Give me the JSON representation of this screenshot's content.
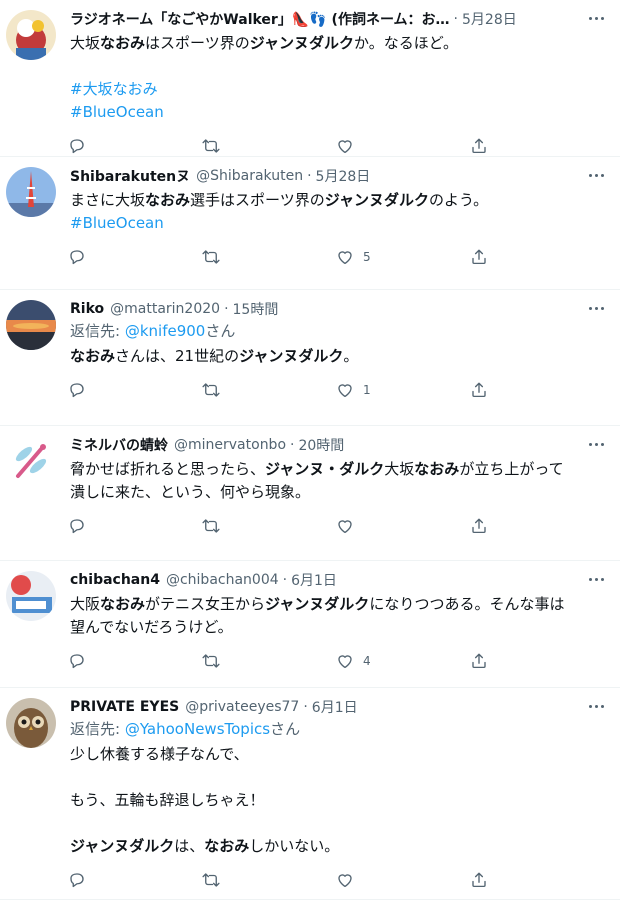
{
  "tweets": [
    {
      "name": "ラジオネーム「なごやかWalker」👠👣 (作詞ネーム：お…",
      "handle": "",
      "time": "5月28日",
      "reply_to": null,
      "lines": [
        [
          {
            "t": "大坂"
          },
          {
            "t": "なおみ",
            "b": true
          },
          {
            "t": "はスポーツ界の"
          },
          {
            "t": "ジャンヌダルク",
            "b": true
          },
          {
            "t": "か。なるほど。"
          }
        ],
        [],
        [
          {
            "t": "#大坂なおみ",
            "tag": true
          }
        ],
        [
          {
            "t": "#BlueOcean",
            "tag": true
          }
        ]
      ],
      "counts": {
        "reply": "",
        "retweet": "",
        "like": "",
        "share": ""
      }
    },
    {
      "name": "Shibarakutenヌ",
      "handle": "@Shibarakuten",
      "time": "5月28日",
      "reply_to": null,
      "lines": [
        [
          {
            "t": "まさに大坂"
          },
          {
            "t": "なおみ",
            "b": true
          },
          {
            "t": "選手はスポーツ界の"
          },
          {
            "t": "ジャンヌダルク",
            "b": true
          },
          {
            "t": "のよう。"
          }
        ],
        [
          {
            "t": "#BlueOcean",
            "tag": true
          }
        ]
      ],
      "counts": {
        "reply": "",
        "retweet": "",
        "like": "5",
        "share": ""
      }
    },
    {
      "name": "Riko",
      "handle": "@mattarin2020",
      "time": "15時間",
      "reply_to": {
        "label": "返信先: ",
        "user": "@knife900",
        "suffix": "さん"
      },
      "lines": [
        [
          {
            "t": "なおみ",
            "b": true
          },
          {
            "t": "さんは、21世紀の"
          },
          {
            "t": "ジャンヌダルク",
            "b": true
          },
          {
            "t": "。"
          }
        ]
      ],
      "counts": {
        "reply": "",
        "retweet": "",
        "like": "1",
        "share": ""
      }
    },
    {
      "name": "ミネルバの蜻蛉",
      "handle": "@minervatonbo",
      "time": "20時間",
      "reply_to": null,
      "lines": [
        [
          {
            "t": "脅かせば折れると思ったら、"
          },
          {
            "t": "ジャンヌ・ダルク",
            "b": true
          },
          {
            "t": "大坂"
          },
          {
            "t": "なおみ",
            "b": true
          },
          {
            "t": "が立ち上がって"
          }
        ],
        [
          {
            "t": "潰しに来た、という、何やら現象。"
          }
        ]
      ],
      "counts": {
        "reply": "",
        "retweet": "",
        "like": "",
        "share": ""
      }
    },
    {
      "name": "chibachan4",
      "handle": "@chibachan004",
      "time": "6月1日",
      "reply_to": null,
      "lines": [
        [
          {
            "t": "大阪"
          },
          {
            "t": "なおみ",
            "b": true
          },
          {
            "t": "がテニス女王から"
          },
          {
            "t": "ジャンヌダルク",
            "b": true
          },
          {
            "t": "になりつつある。そんな事は"
          }
        ],
        [
          {
            "t": "望んでないだろうけど。"
          }
        ]
      ],
      "counts": {
        "reply": "",
        "retweet": "",
        "like": "4",
        "share": ""
      }
    },
    {
      "name": "PRIVATE EYES",
      "handle": "@privateeyes77",
      "time": "6月1日",
      "reply_to": {
        "label": "返信先: ",
        "user": "@YahooNewsTopics",
        "suffix": "さん"
      },
      "lines": [
        [
          {
            "t": "少し休養する様子なんで、"
          }
        ],
        [],
        [
          {
            "t": "もう、五輪も辞退しちゃえ！"
          }
        ],
        [],
        [
          {
            "t": "ジャンヌダルク",
            "b": true
          },
          {
            "t": "は、"
          },
          {
            "t": "なおみ",
            "b": true
          },
          {
            "t": "しかいない。"
          }
        ]
      ],
      "counts": {
        "reply": "",
        "retweet": "",
        "like": "",
        "share": ""
      }
    }
  ],
  "icons": {
    "reply": "reply-icon",
    "retweet": "retweet-icon",
    "like": "heart-icon",
    "share": "share-icon",
    "more": "more-dots-icon"
  },
  "colors": {
    "accent": "#1d9bf0",
    "secondary_text": "#536471",
    "divider": "#eff3f4"
  }
}
